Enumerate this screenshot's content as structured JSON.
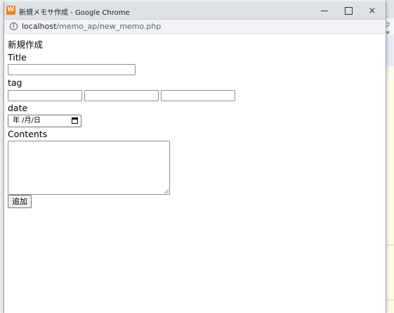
{
  "window": {
    "title": "新規メモサ作成 - Google Chrome",
    "icon_letter": "W",
    "controls": {
      "minimize": "minimize",
      "maximize": "maximize",
      "close": "×"
    }
  },
  "address": {
    "host": "localhost",
    "path": "/memo_ap/new_memo.php"
  },
  "background": {
    "partial_text": "フォ"
  },
  "form": {
    "heading": "新規作成",
    "title_label": "Title",
    "title_value": "",
    "tag_label": "tag",
    "tag_values": [
      "",
      "",
      ""
    ],
    "date_label": "date",
    "date_display": "年 /月/日",
    "contents_label": "Contents",
    "contents_value": "",
    "submit_label": "追加"
  },
  "colors": {
    "titlebar": "#dee1e6",
    "addressbar": "#f1f3f4",
    "app_icon": "#f57d1f"
  }
}
